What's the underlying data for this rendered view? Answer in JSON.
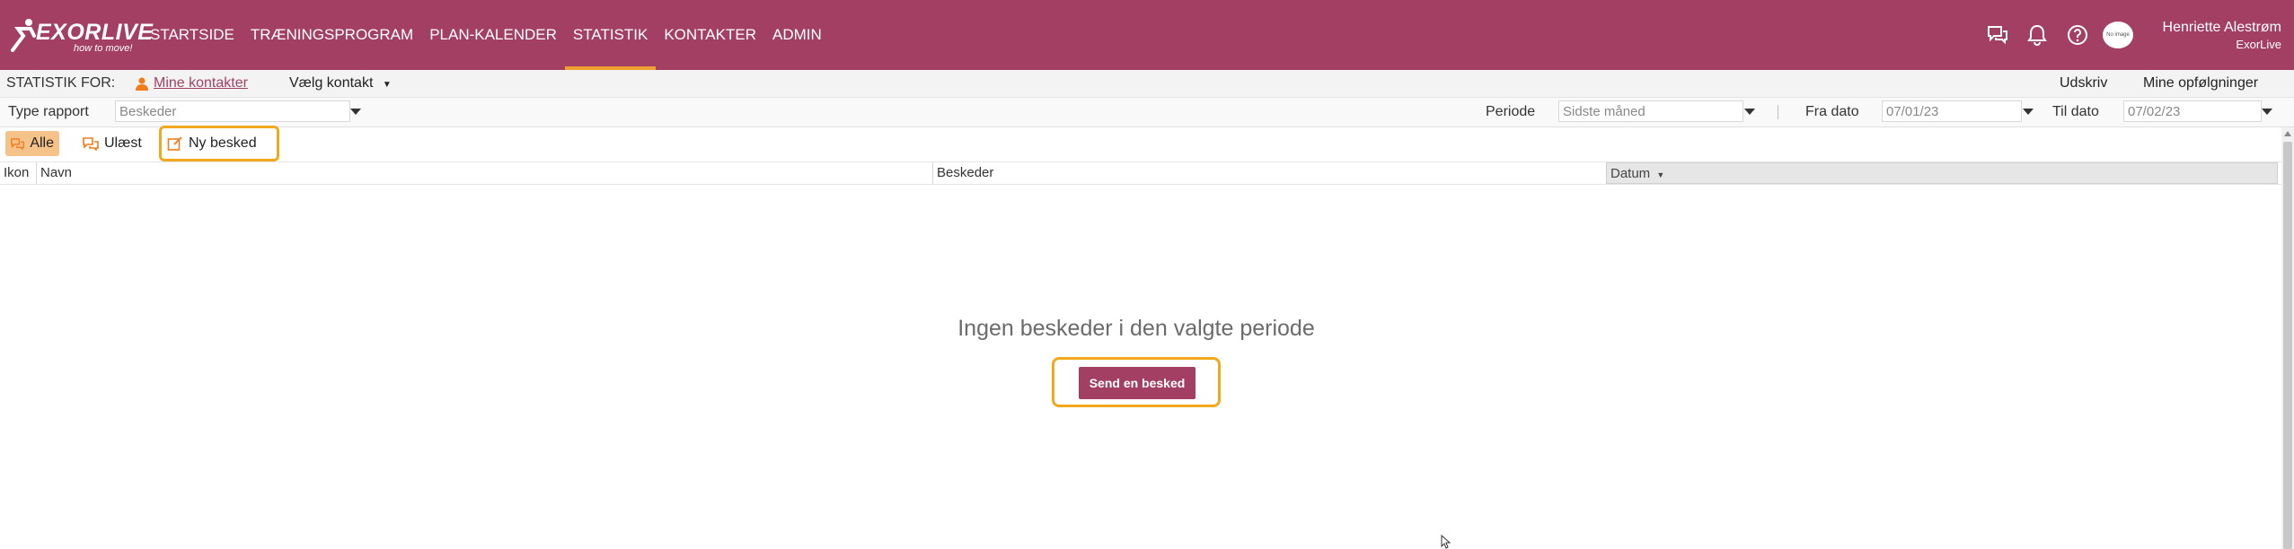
{
  "brand": {
    "logo_text": "EXORLIVE",
    "tagline": "how to move!",
    "accent_color": "#a23f62",
    "highlight_color": "#f2a81d"
  },
  "nav": {
    "items": [
      {
        "label": "STARTSIDE"
      },
      {
        "label": "TRÆNINGSPROGRAM"
      },
      {
        "label": "PLAN-KALENDER"
      },
      {
        "label": "STATISTIK"
      },
      {
        "label": "KONTAKTER"
      },
      {
        "label": "ADMIN"
      }
    ],
    "active": "STATISTIK"
  },
  "header_icons": [
    "chat-icon",
    "bell-icon",
    "help-icon"
  ],
  "user": {
    "name": "Henriette Alestrøm",
    "org": "ExorLive",
    "avatar_text": "No image"
  },
  "stat_bar": {
    "label": "STATISTIK FOR:",
    "mine_contacts": "Mine kontakter",
    "choose_contact": "Vælg kontakt",
    "print": "Udskriv",
    "followups": "Mine opfølgninger"
  },
  "filters": {
    "report_type_label": "Type rapport",
    "report_type_value": "Beskeder",
    "period_label": "Periode",
    "period_value": "Sidste måned",
    "from_label": "Fra dato",
    "from_value": "07/01/23",
    "to_label": "Til dato",
    "to_value": "07/02/23"
  },
  "toolbar": {
    "all": "Alle",
    "unread": "Ulæst",
    "new_message": "Ny besked"
  },
  "table": {
    "columns": [
      "Ikon",
      "Navn",
      "Beskeder",
      "Datum"
    ],
    "sorted_column": "Datum",
    "empty_text": "Ingen beskeder i den valgte periode",
    "send_button": "Send en besked"
  }
}
